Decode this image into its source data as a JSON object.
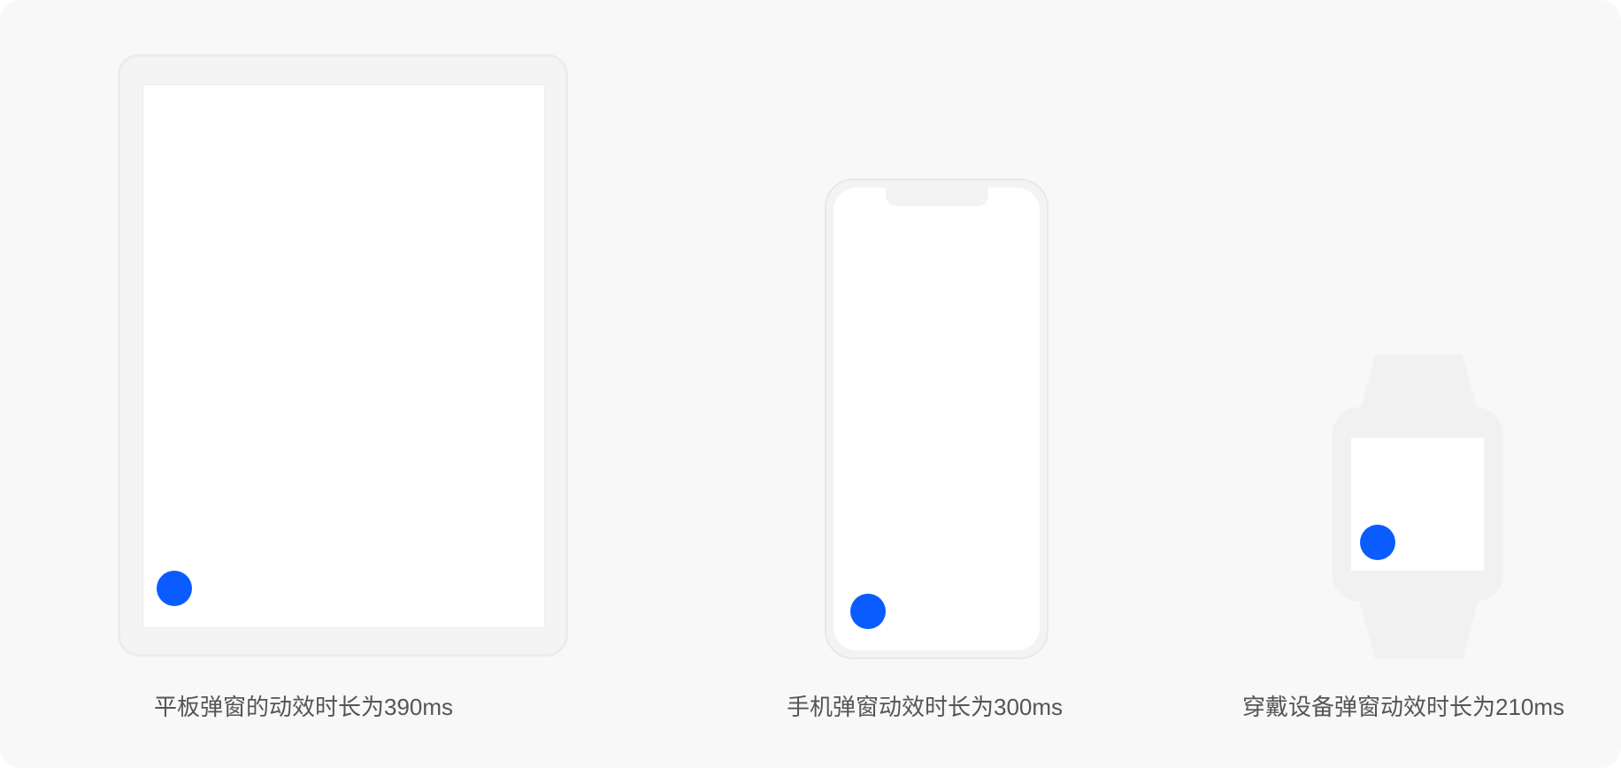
{
  "colors": {
    "accent_dot": "#0a5cff",
    "background": "#f8f8f8",
    "device_frame": "#f3f3f3",
    "screen": "#ffffff",
    "caption_text": "#555555"
  },
  "devices": [
    {
      "name": "tablet",
      "caption": "平板弹窗的动效时长为390ms"
    },
    {
      "name": "phone",
      "caption": "手机弹窗动效时长为300ms"
    },
    {
      "name": "watch",
      "caption": "穿戴设备弹窗动效时长为210ms"
    }
  ]
}
